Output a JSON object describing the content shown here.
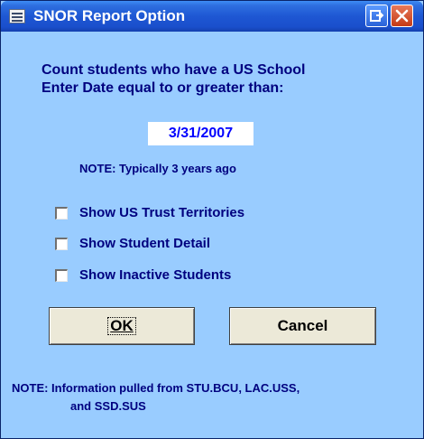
{
  "window": {
    "title": "SNOR Report Option",
    "title_icon": "form-icon",
    "restore_icon": "restore-icon",
    "close_icon": "close-icon"
  },
  "form": {
    "intro_line1": "Count students who have a US School",
    "intro_line2": "Enter Date equal to or greater than:",
    "date_value": "3/31/2007",
    "date_note": "NOTE: Typically 3 years ago",
    "checkboxes": [
      {
        "label": "Show US Trust Territories",
        "checked": false
      },
      {
        "label": "Show Student Detail",
        "checked": false
      },
      {
        "label": "Show Inactive Students",
        "checked": false
      }
    ],
    "ok_label": "OK",
    "cancel_label": "Cancel",
    "footer_note_line1": "NOTE: Information pulled from STU.BCU, LAC.USS,",
    "footer_note_line2": "and SSD.SUS"
  },
  "colors": {
    "titlebar": "#1e57d3",
    "body_background": "#99ccff",
    "label_text": "#00007f",
    "input_text": "#0000ff",
    "button_face": "#ece9d8",
    "close_button": "#c43a16"
  }
}
